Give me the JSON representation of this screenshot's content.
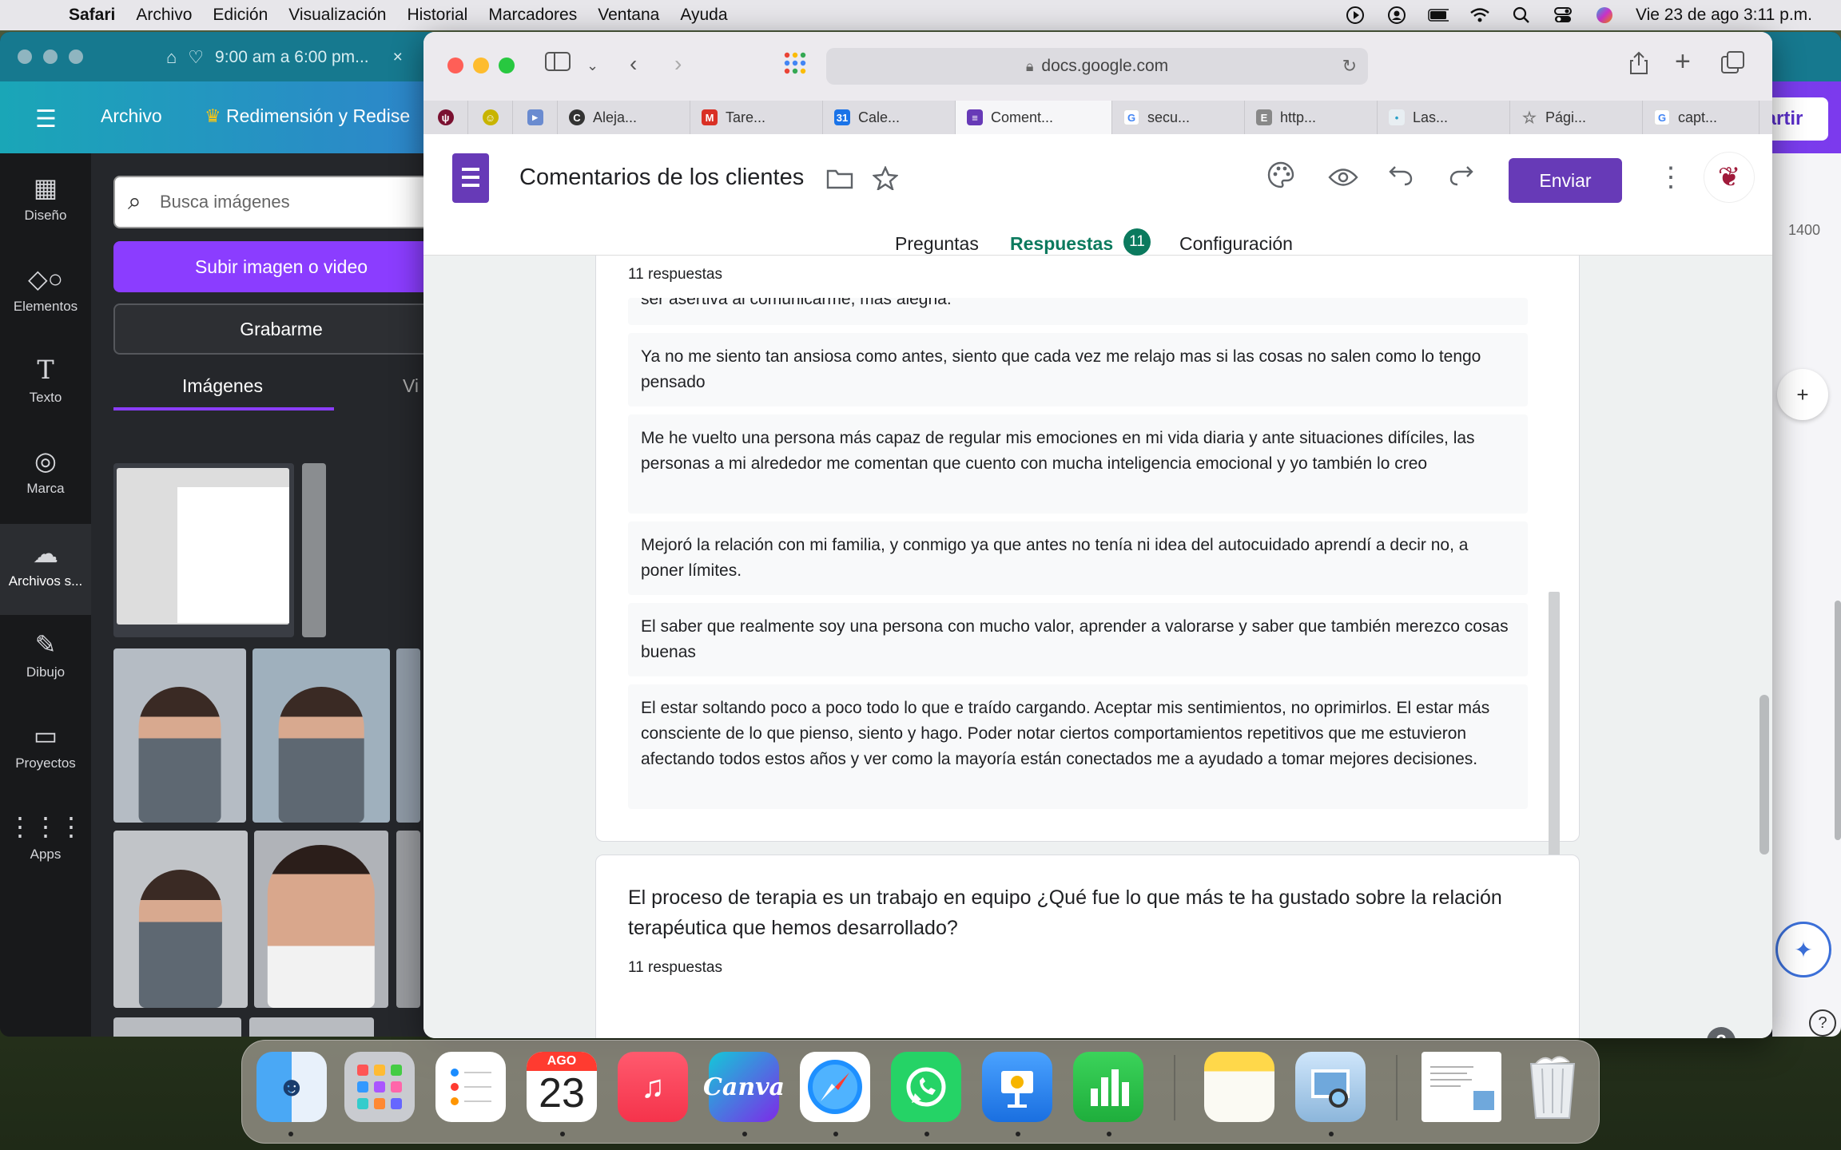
{
  "menubar": {
    "app": "Safari",
    "items": [
      "Archivo",
      "Edición",
      "Visualización",
      "Historial",
      "Marcadores",
      "Ventana",
      "Ayuda"
    ],
    "datetime": "Vie 23 de ago  3:11 p.m."
  },
  "canva": {
    "tab_title": "9:00 am a 6:00 pm...",
    "header": {
      "archivo": "Archivo",
      "title": "Redimensión y Redise",
      "share": "artir"
    },
    "sidebar": [
      {
        "label": "Diseño",
        "icon": "layout-icon"
      },
      {
        "label": "Elementos",
        "icon": "shapes-icon"
      },
      {
        "label": "Texto",
        "icon": "text-icon"
      },
      {
        "label": "Marca",
        "icon": "brand-icon"
      },
      {
        "label": "Archivos s...",
        "icon": "cloud-upload-icon"
      },
      {
        "label": "Dibujo",
        "icon": "draw-icon"
      },
      {
        "label": "Proyectos",
        "icon": "folder-icon"
      },
      {
        "label": "Apps",
        "icon": "apps-grid-icon"
      }
    ],
    "panel": {
      "search_placeholder": "Busca imágenes",
      "upload": "Subir imagen o video",
      "record": "Grabarme",
      "tab_images": "Imágenes",
      "tab_videos": "Vi"
    },
    "ruler": "1400"
  },
  "safari": {
    "address": "docs.google.com",
    "tabs": [
      {
        "label": "",
        "icon": "pinned-site-icon",
        "color": "#7a1030"
      },
      {
        "label": "",
        "icon": "pinned-emoji-icon",
        "color": "#c8b400"
      },
      {
        "label": "",
        "icon": "pinned-logo-icon",
        "color": "#6a8bd0"
      },
      {
        "label": "Aleja...",
        "icon": "c-logo-icon",
        "color": "#333333"
      },
      {
        "label": "Tare...",
        "icon": "gmail-icon",
        "color": "#d93025"
      },
      {
        "label": "Cale...",
        "icon": "calendar-icon",
        "color": "#1a73e8"
      },
      {
        "label": "Coment...",
        "icon": "forms-icon",
        "color": "#673ab7"
      },
      {
        "label": "secu...",
        "icon": "google-icon",
        "color": "#4285f4"
      },
      {
        "label": "http...",
        "icon": "e-logo-icon",
        "color": "#888888"
      },
      {
        "label": "Las...",
        "icon": "dot-icon",
        "color": "#2aa0c8"
      },
      {
        "label": "Pági...",
        "icon": "star-icon",
        "color": "#777777"
      },
      {
        "label": "capt...",
        "icon": "google-icon",
        "color": "#4285f4"
      }
    ]
  },
  "form": {
    "title": "Comentarios de los clientes",
    "send": "Enviar",
    "tabs": {
      "questions": "Preguntas",
      "responses": "Respuestas",
      "settings": "Configuración"
    },
    "responses_badge": "11",
    "accent": "#673ab7",
    "tab_accent": "#0b7a5e"
  },
  "question1": {
    "count": "11 respuestas",
    "partial": "ser asertiva al comunicarme, más alegna.",
    "responses": [
      "Ya no me siento tan ansiosa como antes, siento que cada vez me relajo mas si las cosas no salen como lo tengo pensado",
      "Me he vuelto una persona más capaz de regular mis emociones en mi vida diaria y ante situaciones difíciles, las personas a mi alrededor me comentan que cuento con mucha inteligencia emocional y yo también lo creo",
      "Mejoró la relación con mi familia, y conmigo ya que antes no tenía ni idea del autocuidado aprendí a decir no, a poner límites.",
      "El saber que realmente soy una persona con mucho valor, aprender a valorarse y saber que también merezco cosas buenas",
      "El estar soltando poco a poco todo lo que e traído cargando. Aceptar mis sentimientos, no oprimirlos. El estar más consciente de lo que pienso, siento y hago. Poder notar ciertos comportamientos repetitivos que me estuvieron afectando todos estos años y ver como la mayoría están conectados me a ayudado a tomar mejores decisiones."
    ]
  },
  "question2": {
    "text": "El proceso de terapia es un trabajo en equipo ¿Qué fue lo que más te ha gustado sobre la relación terapéutica que hemos desarrollado?",
    "count": "11 respuestas"
  },
  "dock": {
    "calendar_month": "AGO",
    "calendar_day": "23",
    "canva_label": "Canva",
    "apps": [
      "finder-icon",
      "launchpad-icon",
      "reminders-icon",
      "calendar-icon",
      "music-icon",
      "canva-icon",
      "safari-icon",
      "whatsapp-icon",
      "keynote-icon",
      "numbers-icon",
      "notes-icon",
      "preview-icon",
      "document-thumbnail-icon",
      "trash-icon"
    ]
  }
}
